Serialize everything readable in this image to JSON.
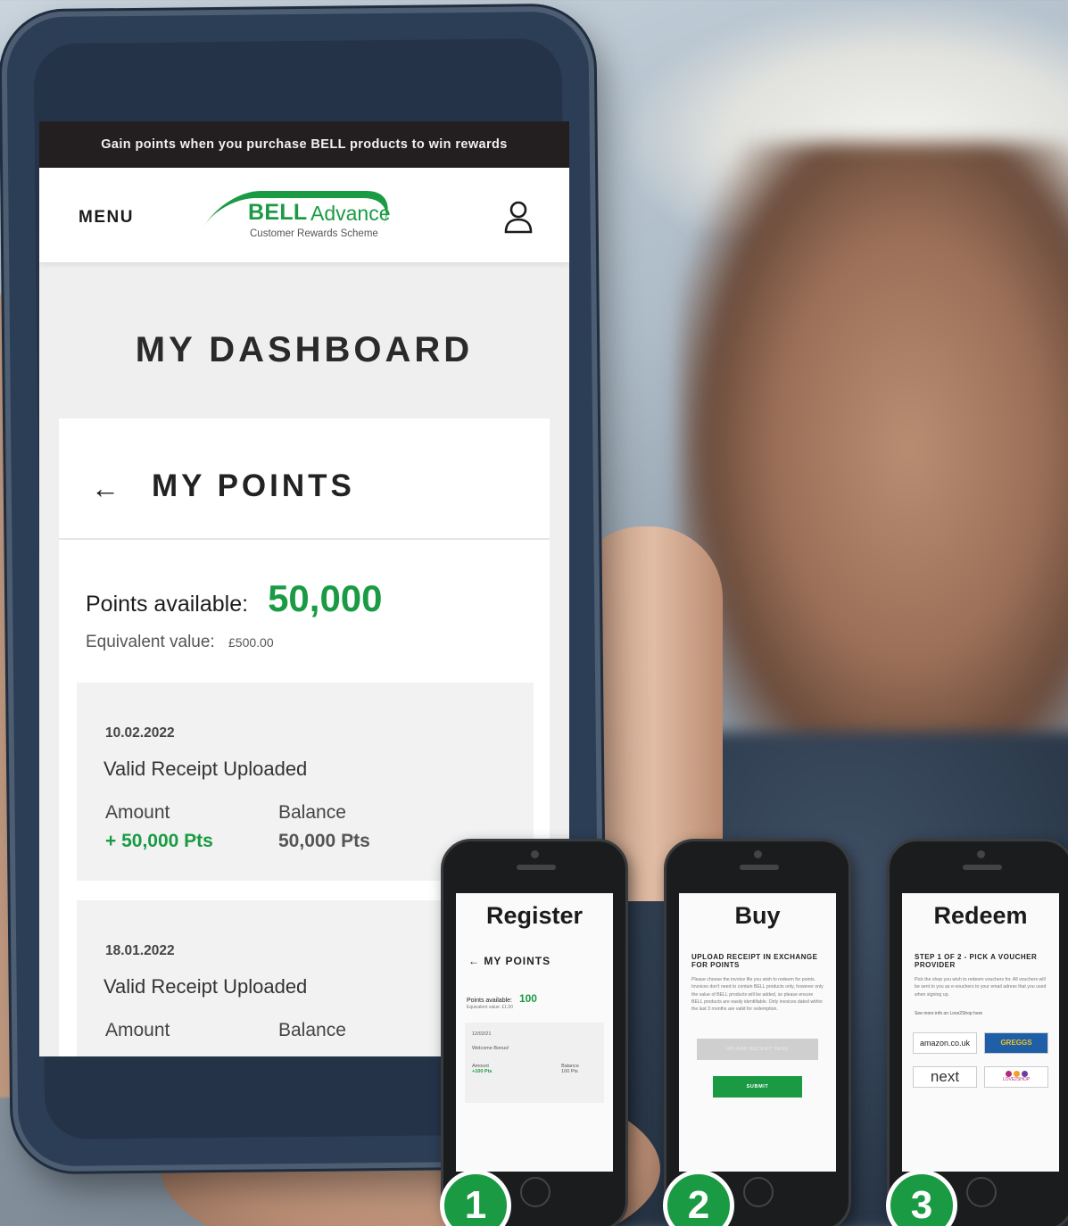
{
  "colors": {
    "brand_green": "#1a9b43",
    "banner_bg": "#231f20",
    "screen_bg": "#efefef"
  },
  "main_phone": {
    "promo_banner": "Gain points when you purchase BELL products to win rewards",
    "header": {
      "menu_label": "MENU",
      "logo_bell": "BELL",
      "logo_advance": "Advance",
      "logo_sub": "Customer Rewards Scheme",
      "user_icon": "user-icon"
    },
    "page_title": "MY DASHBOARD",
    "points_card": {
      "back_icon": "arrow-left-icon",
      "back_arrow": "←",
      "title": "MY POINTS",
      "points_label": "Points available:",
      "points_value": "50,000",
      "equivalent_label": "Equivalent value:",
      "equivalent_value": "£500.00"
    },
    "transactions": [
      {
        "date": "10.02.2022",
        "description": "Valid Receipt Uploaded",
        "amount_label": "Amount",
        "amount": "+ 50,000 Pts",
        "balance_label": "Balance",
        "balance": "50,000 Pts"
      },
      {
        "date": "18.01.2022",
        "description": "Valid Receipt Uploaded",
        "amount_label": "Amount",
        "balance_label": "Balance"
      }
    ]
  },
  "steps": [
    {
      "number": "1",
      "title": "Register",
      "back_label": "← MY POINTS",
      "points_label": "Points available:",
      "points_value": "100",
      "equivalent": "Equivalent value: £1.00",
      "txn_date": "12/02/21",
      "txn_desc": "Welcome Bonus!",
      "amount_label": "Amount",
      "amount": "+100 Pts",
      "balance_label": "Balance",
      "balance": "100 Pts"
    },
    {
      "number": "2",
      "title": "Buy",
      "subtitle": "UPLOAD RECEIPT IN EXCHANGE FOR POINTS",
      "body": "Please choose the invoice file you wish to redeem for points. Invoices don't need to contain BELL products only, however only the value of BELL products will be added, so please ensure BELL products are easily identifiable. Only invoices dated within the last 3 months are valid for redemption.",
      "upload_button": "UPLOAD RECEIPT HERE",
      "submit_button": "SUBMIT"
    },
    {
      "number": "3",
      "title": "Redeem",
      "subtitle": "STEP 1 OF 2 - PICK A VOUCHER PROVIDER",
      "body": "Pick the shop you wish to redeem vouchers for. All vouchers will be sent to you as e-vouchers to your email adress that you used when signing up.",
      "link_text": "See more info on Love2Shop here",
      "providers": [
        "amazon.co.uk",
        "GREGGS",
        "next",
        "LOVE2SHOP"
      ]
    }
  ]
}
